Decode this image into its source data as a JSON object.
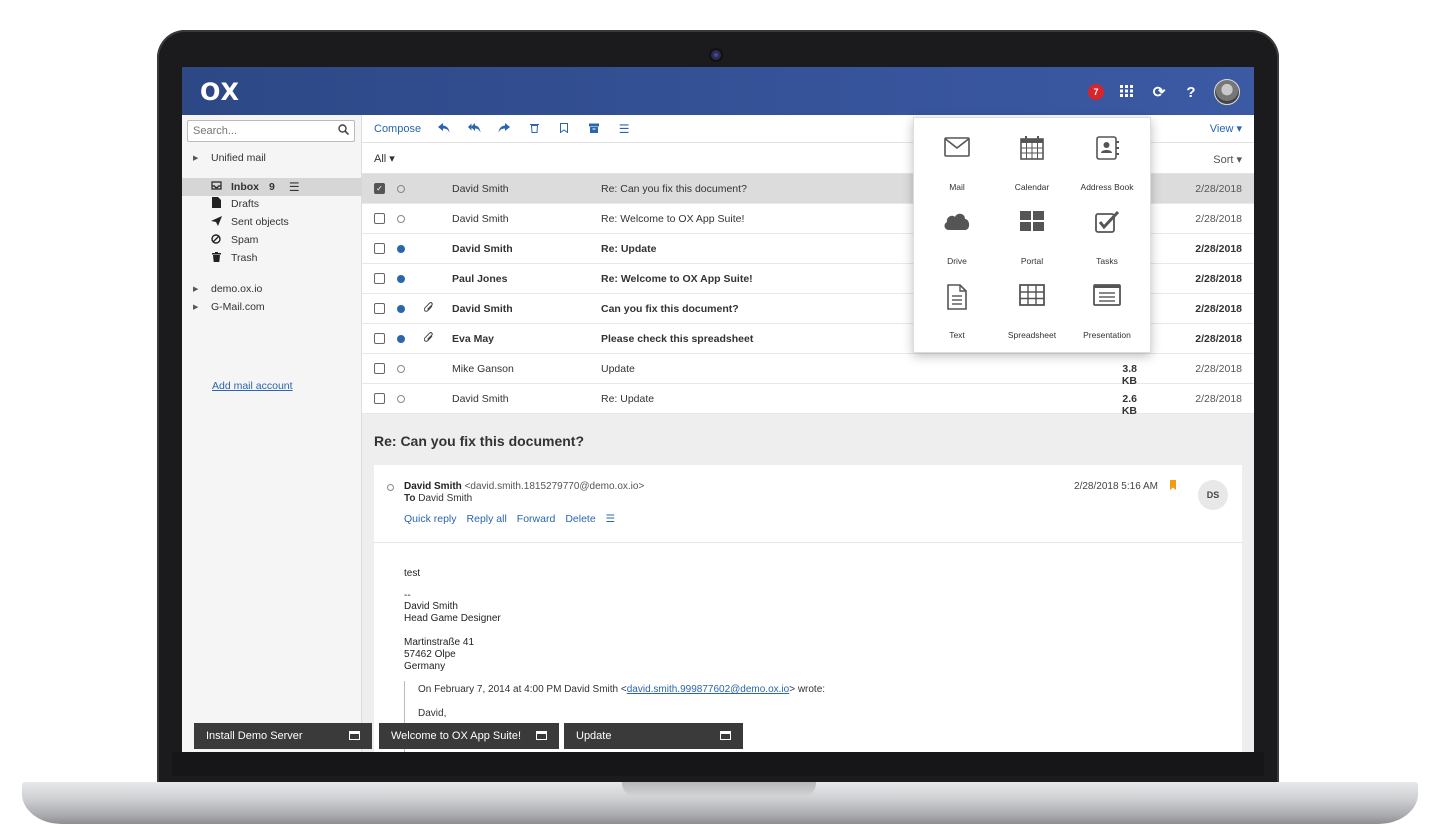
{
  "topbar": {
    "logo": "OX",
    "notification_count": "7"
  },
  "sidebar": {
    "search_placeholder": "Search...",
    "unified_mail": "Unified mail",
    "inbox_label": "Inbox",
    "inbox_count": "9",
    "folders": [
      "Drafts",
      "Sent objects",
      "Spam",
      "Trash"
    ],
    "accounts": [
      "demo.ox.io",
      "G-Mail.com"
    ],
    "add_account": "Add mail account"
  },
  "toolbar": {
    "compose": "Compose",
    "view": "View ▾"
  },
  "filter": {
    "all": "All ▾",
    "sort": "Sort ▾"
  },
  "mails": [
    {
      "from": "David Smith",
      "subject": "Re: Can you fix this document?",
      "size": "",
      "date": "2/28/2018"
    },
    {
      "from": "David Smith",
      "subject": "Re: Welcome to OX App Suite!",
      "size": "",
      "date": "2/28/2018"
    },
    {
      "from": "David Smith",
      "subject": "Re: Update",
      "size": "",
      "date": "2/28/2018"
    },
    {
      "from": "Paul Jones",
      "subject": "Re: Welcome to OX App Suite!",
      "size": "",
      "date": "2/28/2018"
    },
    {
      "from": "David Smith",
      "subject": "Can you fix this document?",
      "size": "",
      "date": "2/28/2018"
    },
    {
      "from": "Eva May",
      "subject": "Please check this spreadsheet",
      "size": "",
      "date": "2/28/2018"
    },
    {
      "from": "Mike Ganson",
      "subject": "Update",
      "size": "3.8 KB",
      "date": "2/28/2018"
    },
    {
      "from": "David Smith",
      "subject": "Re: Update",
      "size": "2.6 KB",
      "date": "2/28/2018"
    }
  ],
  "detail": {
    "subject": "Re: Can you fix this document?",
    "from_name": "David Smith",
    "from_addr": "<david.smith.1815279770@demo.ox.io>",
    "to_label": "To",
    "to_name": "David Smith",
    "date": "2/28/2018 5:16 AM",
    "avatar_initials": "DS",
    "actions": [
      "Quick reply",
      "Reply all",
      "Forward",
      "Delete"
    ],
    "body": [
      "test",
      "--",
      "David Smith",
      "Head Game Designer",
      "Martinstraße 41",
      "57462 Olpe",
      "Germany"
    ],
    "quote_prefix": "On February 7, 2014 at 4:00 PM David Smith <",
    "quote_link": "david.smith.999877602@demo.ox.io",
    "quote_suffix": "> wrote:",
    "quote_line2": "David,"
  },
  "taskbar": [
    "Install Demo Server",
    "Welcome to OX App Suite!",
    "Update"
  ],
  "launcher": {
    "apps": [
      "Mail",
      "Calendar",
      "Address Book",
      "Drive",
      "Portal",
      "Tasks",
      "Text",
      "Spreadsheet",
      "Presentation"
    ]
  },
  "colors": {
    "topbar": "#3b5aa3",
    "link": "#2a65ad",
    "badge": "#d7262b",
    "flag": "#f39c12"
  }
}
